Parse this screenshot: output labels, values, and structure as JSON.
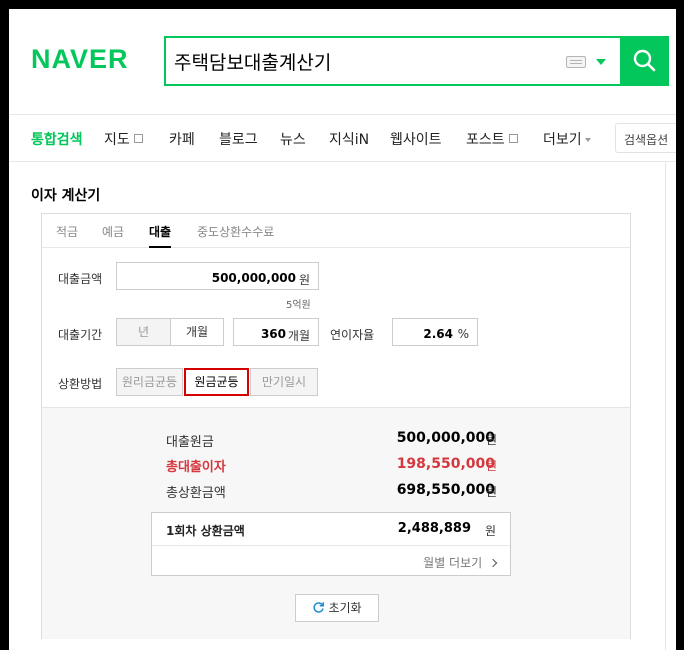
{
  "header": {
    "logo": "NAVER",
    "search_query": "주택담보대출계산기"
  },
  "nav_tabs": [
    {
      "label": "통합검색",
      "active": true
    },
    {
      "label": "지도",
      "external": true
    },
    {
      "label": "카페"
    },
    {
      "label": "블로그"
    },
    {
      "label": "뉴스"
    },
    {
      "label": "지식iN"
    },
    {
      "label": "웹사이트"
    },
    {
      "label": "포스트",
      "external": true
    },
    {
      "label": "더보기",
      "dropdown": true
    }
  ],
  "search_options_label": "검색옵션",
  "calculator": {
    "title": "이자 계산기",
    "tabs": [
      {
        "label": "적금"
      },
      {
        "label": "예금"
      },
      {
        "label": "대출",
        "active": true
      },
      {
        "label": "중도상환수수료"
      }
    ],
    "loan_amount": {
      "label": "대출금액",
      "value": "500,000,000",
      "unit": "원",
      "hint": "5억원"
    },
    "loan_period": {
      "label": "대출기간",
      "unit_year": "년",
      "unit_month": "개월",
      "value": "360",
      "value_unit": "개월"
    },
    "interest_rate": {
      "label": "연이자율",
      "value": "2.64",
      "unit": "%"
    },
    "repayment": {
      "label": "상환방법",
      "options": [
        {
          "label": "원리금균등"
        },
        {
          "label": "원금균등",
          "selected": true
        },
        {
          "label": "만기일시"
        }
      ]
    },
    "results": {
      "principal": {
        "label": "대출원금",
        "value": "500,000,000",
        "unit": "원"
      },
      "total_interest": {
        "label": "총대출이자",
        "value": "198,550,000",
        "unit": "원"
      },
      "total_repayment": {
        "label": "총상환금액",
        "value": "698,550,000",
        "unit": "원"
      }
    },
    "first_payment": {
      "label": "1회차 상환금액",
      "value": "2,488,889",
      "unit": "원",
      "more_label": "월별 더보기"
    },
    "reset_label": "초기화"
  },
  "colors": {
    "brand": "#03c75a",
    "highlight": "#d4373e",
    "selected_border": "#d40000"
  }
}
